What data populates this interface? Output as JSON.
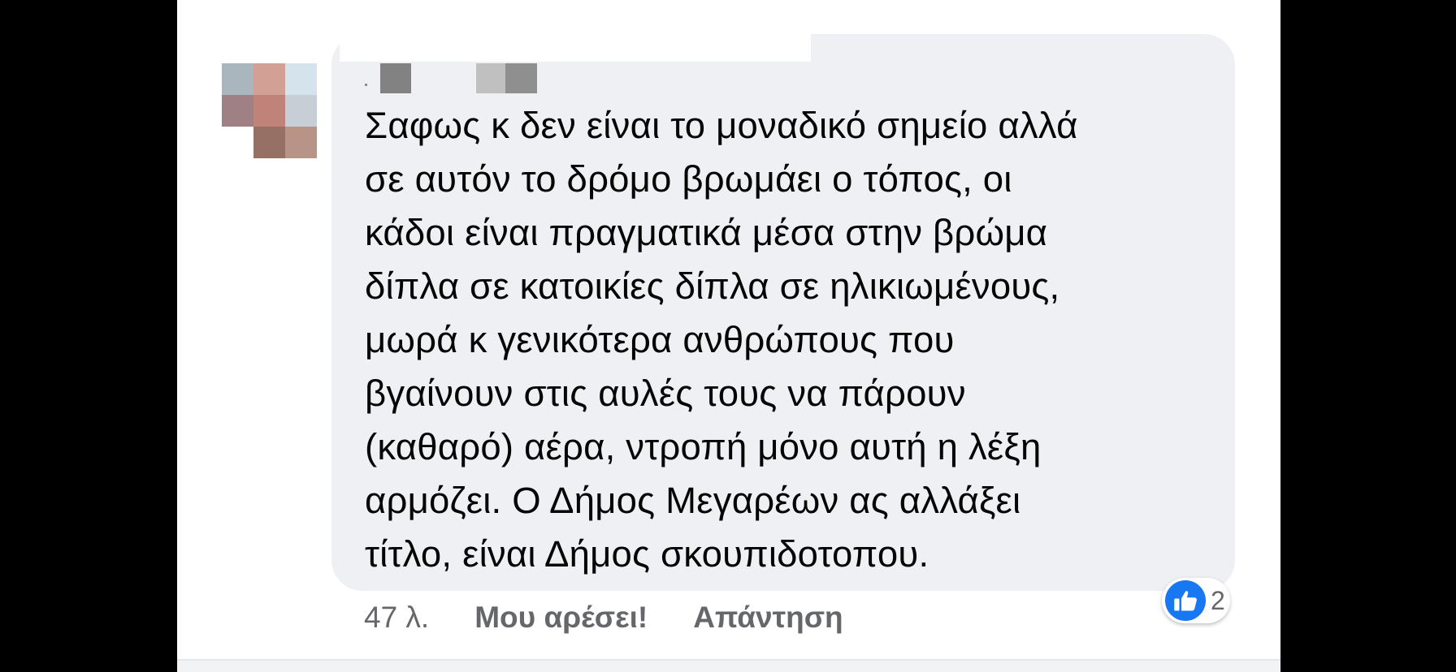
{
  "comment": {
    "text": "Σαφως κ δεν είναι το μοναδικό σημείο αλλά\nσε αυτόν το δρόμο βρωμάει ο τόπος, οι\nκάδοι είναι πραγματικά μέσα στην βρώμα\nδίπλα σε κατοικίες δίπλα σε ηλικιωμένους,\nμωρά κ γενικότερα ανθρώπους που\nβγαίνουν στις αυλές τους να πάρουν\n(καθαρό) αέρα, ντροπή μόνο αυτή η λέξη\nαρμόζει. Ο Δήμος Μεγαρέων ας αλλάξει\nτίτλο, είναι Δήμος σκουπιδοτοπου.",
    "timestamp": "47 λ.",
    "like_label": "Μου αρέσει!",
    "reply_label": "Απάντηση",
    "reaction_count": "2",
    "reaction_icon": "thumbs-up-icon",
    "reaction_color": "#1877f2"
  },
  "colors": {
    "bubble": "#eff0f3",
    "meta_text": "#65676b",
    "body_text": "#050505"
  }
}
